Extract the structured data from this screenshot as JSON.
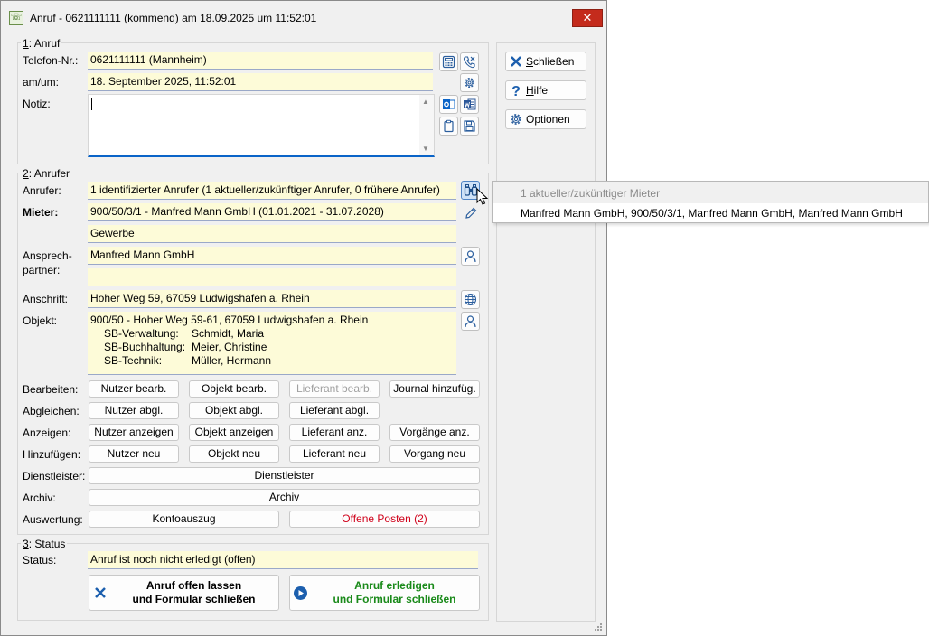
{
  "window": {
    "title": "Anruf - 0621111111 (kommend) am 18.09.2025 um 11:52:01",
    "close_glyph": "✕"
  },
  "group1": {
    "label_mnemonic": "1",
    "label_rest": ": Anruf",
    "telefon_label": "Telefon-Nr.:",
    "telefon_value": "0621111111  (Mannheim)",
    "amum_label": "am/um:",
    "amum_value": "18. September 2025,  11:52:01",
    "notiz_label": "Notiz:",
    "notiz_value": ""
  },
  "group2": {
    "label_mnemonic": "2",
    "label_rest": ": Anrufer",
    "anrufer_label": "Anrufer:",
    "anrufer_value": "1 identifizierter Anrufer  (1 aktueller/zukünftiger Anrufer,  0 frühere Anrufer)",
    "mieter_label": "Mieter:",
    "mieter_value": "900/50/3/1 - Manfred Mann GmbH  (01.01.2021 - 31.07.2028)",
    "mieter_line2": "Gewerbe",
    "ansprech_label_1": "Ansprech-",
    "ansprech_label_2": "partner:",
    "ansprech_value": "Manfred Mann GmbH",
    "ansprech_value2": "",
    "anschrift_label": "Anschrift:",
    "anschrift_value": "Hoher Weg 59, 67059 Ludwigshafen a. Rhein",
    "objekt_label": "Objekt:",
    "objekt_line1": "900/50 - Hoher Weg 59-61, 67059 Ludwigshafen a. Rhein",
    "objekt_rows": [
      {
        "role": "SB-Verwaltung:",
        "name": "Schmidt, Maria"
      },
      {
        "role": "SB-Buchhaltung:",
        "name": "Meier, Christine"
      },
      {
        "role": "SB-Technik:",
        "name": "Müller, Hermann"
      }
    ]
  },
  "actions": {
    "bearbeiten": {
      "label": "Bearbeiten:",
      "buttons": [
        "Nutzer bearb.",
        "Objekt bearb.",
        "Lieferant bearb.",
        "Journal hinzufüg."
      ]
    },
    "abgleichen": {
      "label": "Abgleichen:",
      "buttons": [
        "Nutzer abgl.",
        "Objekt abgl.",
        "Lieferant abgl."
      ]
    },
    "anzeigen": {
      "label": "Anzeigen:",
      "buttons": [
        "Nutzer anzeigen",
        "Objekt anzeigen",
        "Lieferant anz.",
        "Vorgänge anz."
      ]
    },
    "hinzufuegen": {
      "label": "Hinzufügen:",
      "buttons": [
        "Nutzer neu",
        "Objekt neu",
        "Lieferant neu",
        "Vorgang neu"
      ]
    },
    "dienstleister": {
      "label": "Dienstleister:",
      "button": "Dienstleister"
    },
    "archiv": {
      "label": "Archiv:",
      "button": "Archiv"
    },
    "auswertung": {
      "label": "Auswertung:",
      "buttons": [
        "Kontoauszug",
        "Offene Posten (2)"
      ]
    }
  },
  "group3": {
    "label_mnemonic": "3",
    "label_rest": ": Status",
    "status_label": "Status:",
    "status_value": "Anruf ist noch nicht erledigt (offen)",
    "btn_offen": "Anruf offen lassen\nund Formular schließen",
    "btn_erledigt": "Anruf erledigen\nund Formular schließen"
  },
  "sidebar": {
    "schliessen_mnemonic": "S",
    "schliessen_rest": "chließen",
    "hilfe_mnemonic": "H",
    "hilfe_rest": "ilfe",
    "optionen": "Optionen"
  },
  "popup": {
    "header": "1 aktueller/zukünftiger Mieter",
    "item": "Manfred Mann GmbH, 900/50/3/1, Manfred Mann GmbH, Manfred Mann GmbH"
  },
  "colors": {
    "field_bg": "#fdfbd8",
    "accent_blue": "#0a64c8",
    "close_red": "#c42b1c",
    "erledigt_green": "#1a8a1a",
    "offene_posten_red": "#d0021b"
  },
  "icons": [
    "calculator-icon",
    "phone-cancel-icon",
    "gear-icon",
    "outlook-icon",
    "word-icon",
    "clipboard-icon",
    "save-icon",
    "binoculars-icon",
    "pencil-icon",
    "person-icon",
    "globe-icon",
    "close-x-icon",
    "help-icon",
    "play-circle-icon"
  ]
}
